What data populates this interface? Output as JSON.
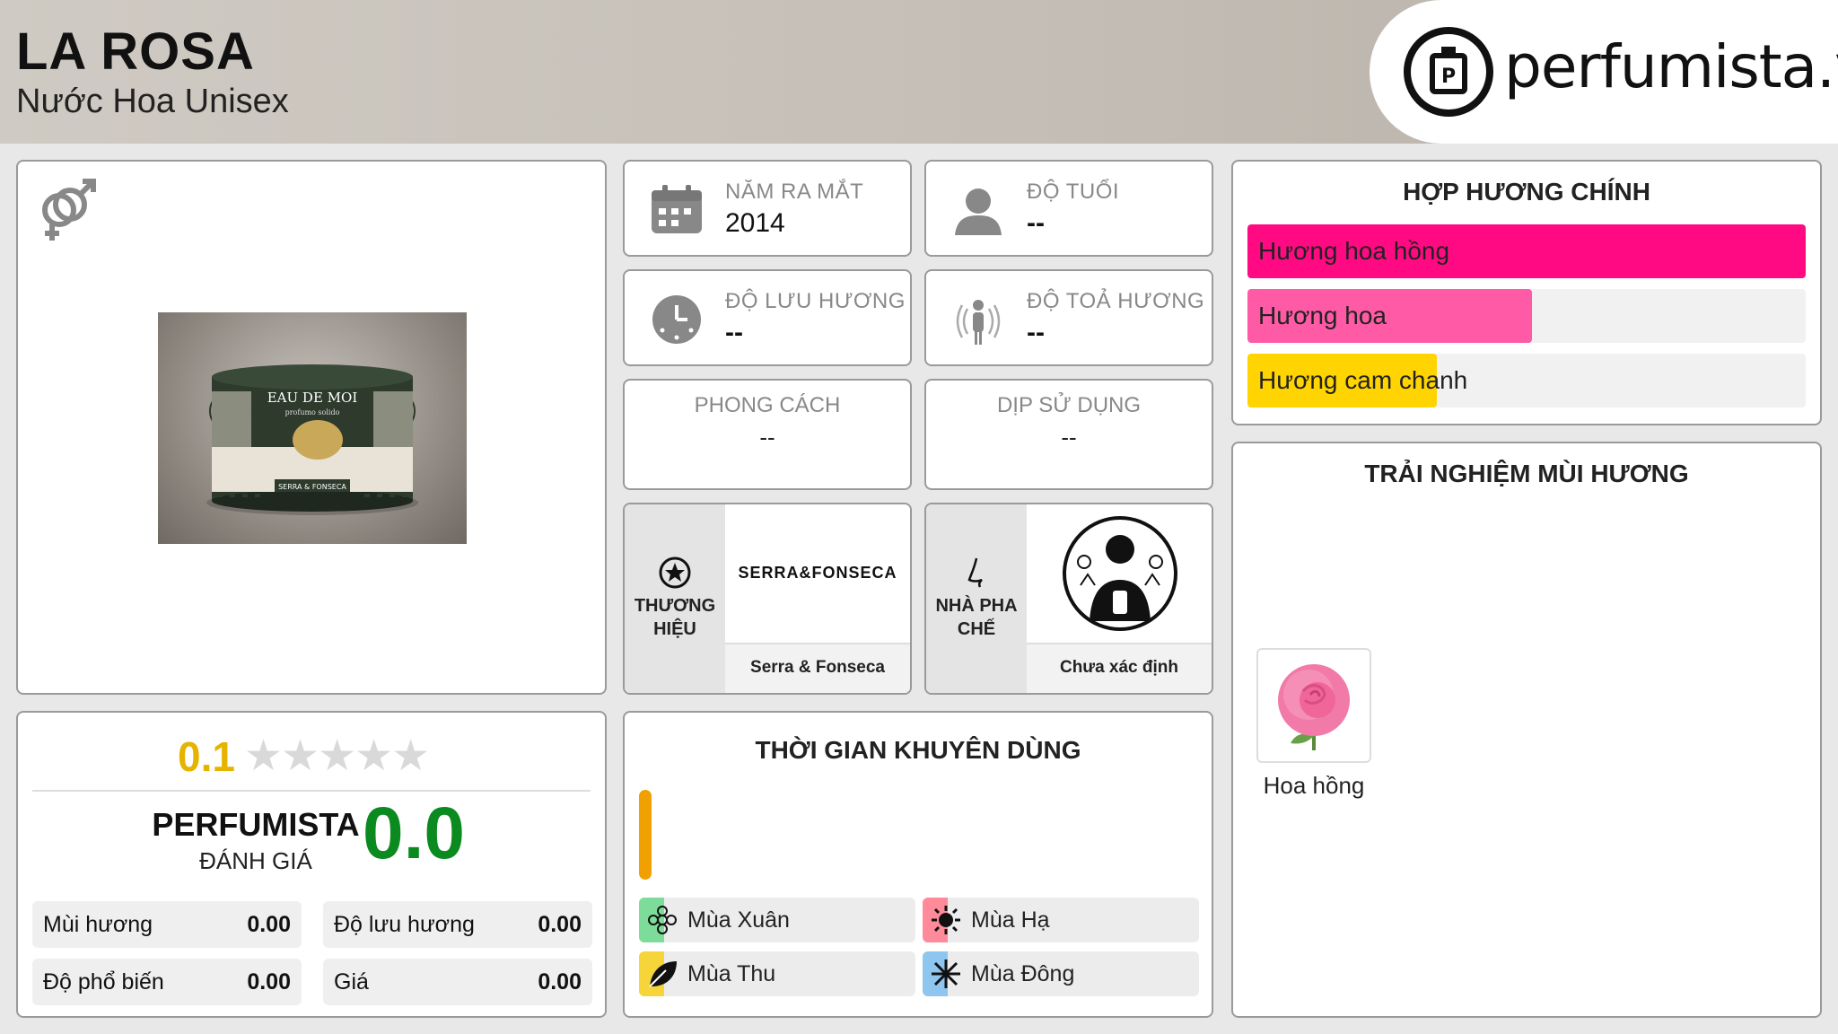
{
  "header": {
    "title": "LA ROSA",
    "subtitle": "Nước Hoa Unisex",
    "logo_text": "perfumista.vn"
  },
  "product": {
    "gender_icon": "male-female-icon",
    "image_label": "EAU DE MOI",
    "image_sub": "profumo solido",
    "image_brand": "SERRA & FONSECA"
  },
  "info": {
    "year": {
      "title": "NĂM RA MẮT",
      "value": "2014",
      "icon": "calendar-icon"
    },
    "age": {
      "title": "ĐỘ TUỔI",
      "value": "--",
      "icon": "person-icon"
    },
    "longevity": {
      "title": "ĐỘ LƯU HƯƠNG",
      "value": "--",
      "icon": "clock-icon"
    },
    "sillage": {
      "title": "ĐỘ TOẢ HƯƠNG",
      "value": "--",
      "icon": "sillage-icon"
    },
    "style": {
      "title": "PHONG CÁCH",
      "value": "--"
    },
    "occasion": {
      "title": "DỊP SỬ DỤNG",
      "value": "--"
    }
  },
  "brand": {
    "label_line1": "THƯƠNG",
    "label_line2": "HIỆU",
    "logo_text": "SERRA&FONSECA",
    "name": "Serra & Fonseca",
    "icon": "star-badge-icon"
  },
  "perfumer": {
    "label_line1": "NHÀ PHA",
    "label_line2": "CHẾ",
    "name": "Chưa xác định",
    "icon": "nose-icon"
  },
  "accords": {
    "title": "HỢP HƯƠNG CHÍNH",
    "items": [
      {
        "label": "Hương hoa hồng",
        "percent": 100,
        "color": "#ff0a82"
      },
      {
        "label": "Hương hoa",
        "percent": 51,
        "color": "#ff5aa5"
      },
      {
        "label": "Hương cam chanh",
        "percent": 34,
        "color": "#ffd400"
      }
    ]
  },
  "experience": {
    "title": "TRẢI NGHIỆM MÙI HƯƠNG",
    "notes": [
      {
        "label": "Hoa hồng",
        "icon": "rose-icon"
      }
    ]
  },
  "rating": {
    "user_score": "0.1",
    "stars": 5,
    "pf_label": "PERFUMISTA",
    "pf_sub": "ĐÁNH GIÁ",
    "pf_score": "0.0",
    "metrics": [
      {
        "label": "Mùi hương",
        "value": "0.00"
      },
      {
        "label": "Độ lưu hương",
        "value": "0.00"
      },
      {
        "label": "Độ phổ biến",
        "value": "0.00"
      },
      {
        "label": "Giá",
        "value": "0.00"
      }
    ]
  },
  "time": {
    "title": "THỜI GIAN KHUYÊN DÙNG",
    "seasons": [
      {
        "label": "Mùa Xuân",
        "color": "#7ddc9a",
        "icon": "flower-icon"
      },
      {
        "label": "Mùa Hạ",
        "color": "#ff8a9a",
        "icon": "sun-icon"
      },
      {
        "label": "Mùa Thu",
        "color": "#f6d53a",
        "icon": "leaf-icon"
      },
      {
        "label": "Mùa Đông",
        "color": "#8ec6f0",
        "icon": "snowflake-icon"
      }
    ]
  }
}
